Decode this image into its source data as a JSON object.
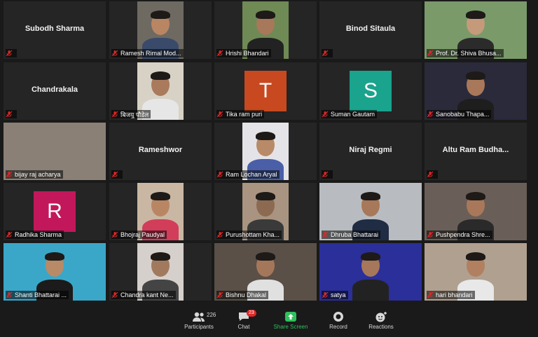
{
  "participants": [
    {
      "label": "",
      "display_name": "Subodh Sharma",
      "kind": "name"
    },
    {
      "label": "Ramesh Rimal Mod...",
      "kind": "video",
      "bg": "#6e6a62",
      "skin": "#b98664",
      "shirt": "#3a4a6a"
    },
    {
      "label": "Hrishi Bhandari",
      "kind": "video",
      "bg": "#6f8a55",
      "skin": "#a7785a",
      "shirt": "#222222"
    },
    {
      "label": "",
      "display_name": "Binod Sitaula",
      "kind": "name"
    },
    {
      "label": "Prof. Dr. Shiva Bhusa...",
      "kind": "video",
      "bg": "#7a9a6a",
      "skin": "#c49a7b",
      "shirt": "#2b2b2b",
      "active": true
    },
    {
      "label": "",
      "display_name": "Chandrakala",
      "kind": "name"
    },
    {
      "label": "बिजयु पौडेल",
      "kind": "video",
      "bg": "#d8d2c6",
      "skin": "#a97a5c",
      "shirt": "#e6e6e6"
    },
    {
      "label": "Tika ram puri",
      "kind": "avatar",
      "letter": "T",
      "color": "#c8491f"
    },
    {
      "label": "Suman Gautam",
      "kind": "avatar",
      "letter": "S",
      "color": "#1aa38d"
    },
    {
      "label": "Sanobabu Thapa...",
      "kind": "video",
      "bg": "#2a2a3a",
      "skin": "#a9785a",
      "shirt": "#1e1e1e"
    },
    {
      "label": "bijay raj acharya",
      "kind": "video",
      "bg": "#8a8076",
      "skin": "#8a8076",
      "shirt": "#5a5249",
      "blank": true
    },
    {
      "label": "",
      "display_name": "Rameshwor",
      "kind": "name"
    },
    {
      "label": "Ram Lochan Aryal",
      "kind": "video",
      "bg": "#e4e4e8",
      "skin": "#b88a68",
      "shirt": "#4a5fa8"
    },
    {
      "label": "",
      "display_name": "Niraj Regmi",
      "kind": "name"
    },
    {
      "label": "",
      "display_name": "Altu Ram Budha...",
      "kind": "name"
    },
    {
      "label": "Radhika Sharma",
      "kind": "avatar",
      "letter": "R",
      "color": "#c2185b"
    },
    {
      "label": "Bhojraj Paudyal",
      "kind": "video",
      "bg": "#c9b7a3",
      "skin": "#b98664",
      "shirt": "#d23d5a"
    },
    {
      "label": "Purushottam Kha...",
      "kind": "video",
      "bg": "#a89480",
      "skin": "#8c6a52",
      "shirt": "#3a3a3a"
    },
    {
      "label": "Dhruba Bhattarai",
      "kind": "video",
      "bg": "#b8bcc0",
      "skin": "#a7785a",
      "shirt": "#1f2c44"
    },
    {
      "label": "Pushpendra Shre...",
      "kind": "video",
      "bg": "#6a5f58",
      "skin": "#a9785a",
      "shirt": "#2a2a2a"
    },
    {
      "label": "Shanti Bhattarai ...",
      "kind": "video",
      "bg": "#3aa7c8",
      "skin": "#b88a68",
      "shirt": "#1b1b1b"
    },
    {
      "label": "Chandra kant Ne...",
      "kind": "video",
      "bg": "#d6d0cc",
      "skin": "#a17a5e",
      "shirt": "#444444"
    },
    {
      "label": "Bishnu Dhakal",
      "kind": "video",
      "bg": "#5a5048",
      "skin": "#a5775a",
      "shirt": "#e0e0e0"
    },
    {
      "label": "satya",
      "kind": "video",
      "bg": "#2b2f9a",
      "skin": "#a6775a",
      "shirt": "#222222"
    },
    {
      "label": "hari bhandari",
      "kind": "video",
      "bg": "#b0a090",
      "skin": "#b08060",
      "shirt": "#e8e8e8"
    }
  ],
  "toolbar": {
    "participants_label": "Participants",
    "participants_count": "226",
    "chat_label": "Chat",
    "chat_badge": "23",
    "share_label": "Share Screen",
    "record_label": "Record",
    "reactions_label": "Reactions"
  },
  "colors": {
    "background": "#1a1a1a",
    "tile": "#252525",
    "active_border": "#d7d84b",
    "muted": "#e02828",
    "share": "#2fc05c"
  }
}
